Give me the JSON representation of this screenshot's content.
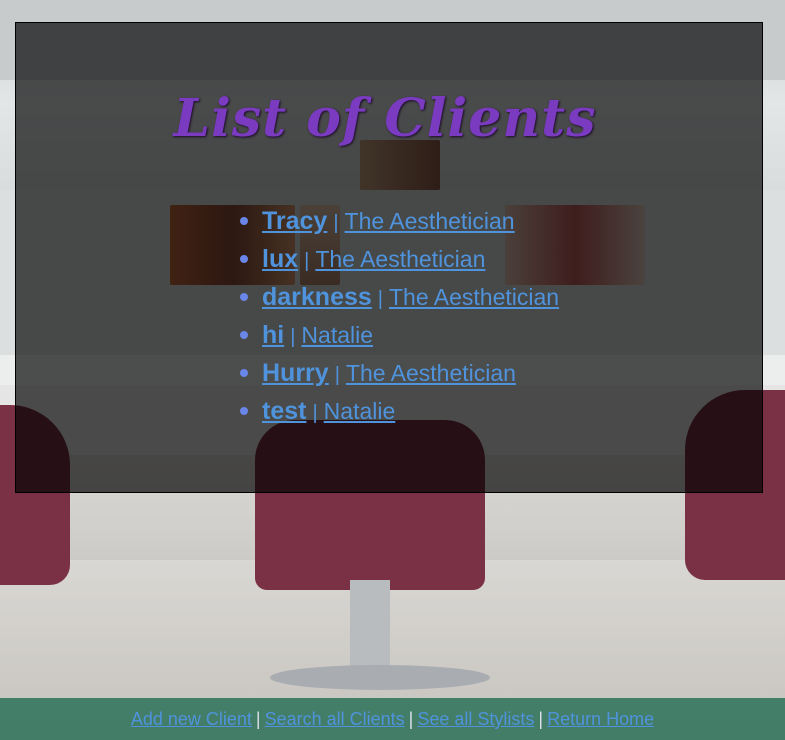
{
  "page": {
    "title": "List of Clients"
  },
  "clients": [
    {
      "name": "Tracy",
      "stylist": "The Aesthetician"
    },
    {
      "name": "lux",
      "stylist": "The Aesthetician"
    },
    {
      "name": "darkness",
      "stylist": "The Aesthetician"
    },
    {
      "name": "hi",
      "stylist": "Natalie"
    },
    {
      "name": "Hurry",
      "stylist": "The Aesthetician"
    },
    {
      "name": "test",
      "stylist": "Natalie"
    }
  ],
  "separator": "|",
  "footer": {
    "links": [
      {
        "label": "Add new Client"
      },
      {
        "label": "Search all Clients"
      },
      {
        "label": "See all Stylists"
      },
      {
        "label": "Return Home"
      }
    ]
  },
  "colors": {
    "title": "#7a3bc1",
    "link": "#4f93dc",
    "footer_bg": "#1e6950",
    "panel_bg": "#000000"
  }
}
